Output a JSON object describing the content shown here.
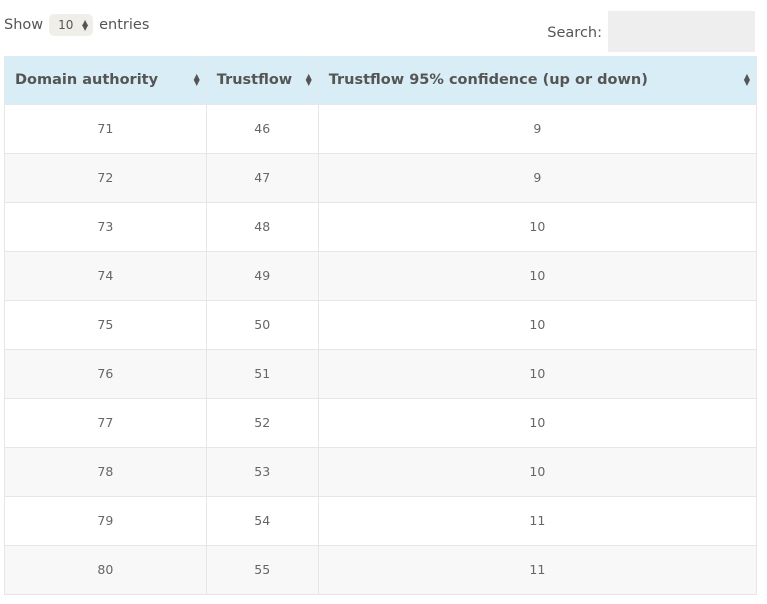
{
  "length_control": {
    "prefix": "Show",
    "selected": "10",
    "suffix": "entries"
  },
  "search": {
    "label": "Search:",
    "value": "",
    "placeholder": ""
  },
  "table": {
    "columns": [
      {
        "label": "Domain authority",
        "sort_icon": "sort-both-icon"
      },
      {
        "label": "Trustflow",
        "sort_icon": "sort-both-icon"
      },
      {
        "label": "Trustflow 95% confidence (up or down)",
        "sort_icon": "sort-both-icon"
      }
    ],
    "rows": [
      [
        "71",
        "46",
        "9"
      ],
      [
        "72",
        "47",
        "9"
      ],
      [
        "73",
        "48",
        "10"
      ],
      [
        "74",
        "49",
        "10"
      ],
      [
        "75",
        "50",
        "10"
      ],
      [
        "76",
        "51",
        "10"
      ],
      [
        "77",
        "52",
        "10"
      ],
      [
        "78",
        "53",
        "10"
      ],
      [
        "79",
        "54",
        "11"
      ],
      [
        "80",
        "55",
        "11"
      ]
    ]
  },
  "colors": {
    "header_bg": "#d9edf7",
    "stripe_bg": "#f8f8f8",
    "search_bg": "#eeeeee",
    "select_bg": "#efeee9"
  }
}
